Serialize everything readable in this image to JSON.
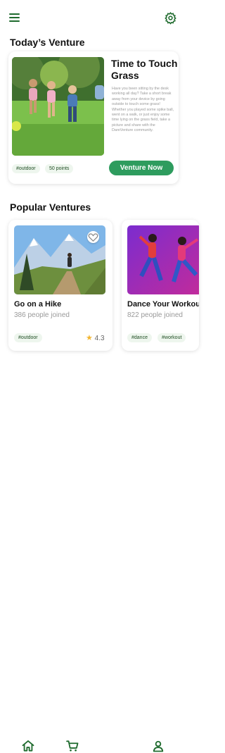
{
  "today": {
    "section_title": "Today’s Venture",
    "title": "Time to Touch Grass",
    "description": "Have you been sitting by the desk working all day? Take a short break away from your device by going outside to touch some grass! Whether you played some spike ball, went on a walk, or just enjoy some time lying on the grass field, take a picture and share with the DareVenture community.",
    "tags": [
      "#outdoor",
      "50 points"
    ],
    "button_label": "Venture Now"
  },
  "popular": {
    "section_title": "Popular Ventures",
    "cards": [
      {
        "title": "Go on a Hike",
        "joined": "386 people joined",
        "tags": [
          "#outdoor"
        ],
        "rating": "4.3"
      },
      {
        "title": "Dance Your Workout",
        "joined": "822 people joined",
        "tags": [
          "#dance",
          "#workout"
        ]
      }
    ]
  },
  "nav": {
    "items": [
      "home-icon",
      "cart-icon",
      "profile-icon"
    ]
  },
  "colors": {
    "accent": "#2e9c5e",
    "icon": "#1f6b2e",
    "tag_bg": "#eef6ee"
  }
}
